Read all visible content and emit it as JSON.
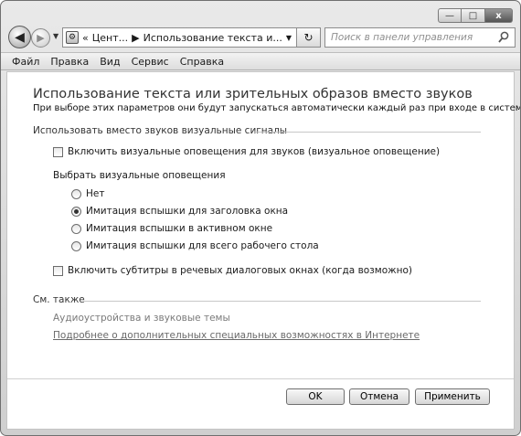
{
  "window": {
    "minimize": "—",
    "maximize": "□",
    "close": "x"
  },
  "nav": {
    "back_glyph": "◀",
    "forward_glyph": "▶",
    "dropdown_glyph": "▼"
  },
  "address": {
    "prefix": "«",
    "crumb1": "Цент...",
    "separator": "▶",
    "crumb2": "Использование текста и...",
    "dropdown_glyph": "▼",
    "refresh_glyph": "↻"
  },
  "search": {
    "placeholder": "Поиск в панели управления"
  },
  "menu": [
    "Файл",
    "Правка",
    "Вид",
    "Сервис",
    "Справка"
  ],
  "page": {
    "title": "Использование текста или зрительных образов вместо звуков",
    "description": "При выборе этих параметров они будут запускаться автоматически каждый раз при входе в систему."
  },
  "visual_signals": {
    "heading": "Использовать вместо звуков визуальные сигналы",
    "enable_checkbox": {
      "label": "Включить визуальные оповещения для звуков (визуальное оповещение)",
      "checked": false
    },
    "choose_label": "Выбрать визуальные оповещения",
    "options": [
      {
        "label": "Нет",
        "selected": false
      },
      {
        "label": "Имитация вспышки для заголовка окна",
        "selected": true
      },
      {
        "label": "Имитация вспышки в активном окне",
        "selected": false
      },
      {
        "label": "Имитация вспышки для всего рабочего стола",
        "selected": false
      }
    ],
    "captions_checkbox": {
      "label": "Включить субтитры в речевых диалоговых окнах (когда возможно)",
      "checked": false
    }
  },
  "see_also": {
    "heading": "См. также",
    "item": "Аудиоустройства и звуковые темы",
    "link": "Подробнее о дополнительных специальных возможностях в Интернете"
  },
  "buttons": {
    "ok": "OK",
    "cancel": "Отмена",
    "apply": "Применить"
  }
}
